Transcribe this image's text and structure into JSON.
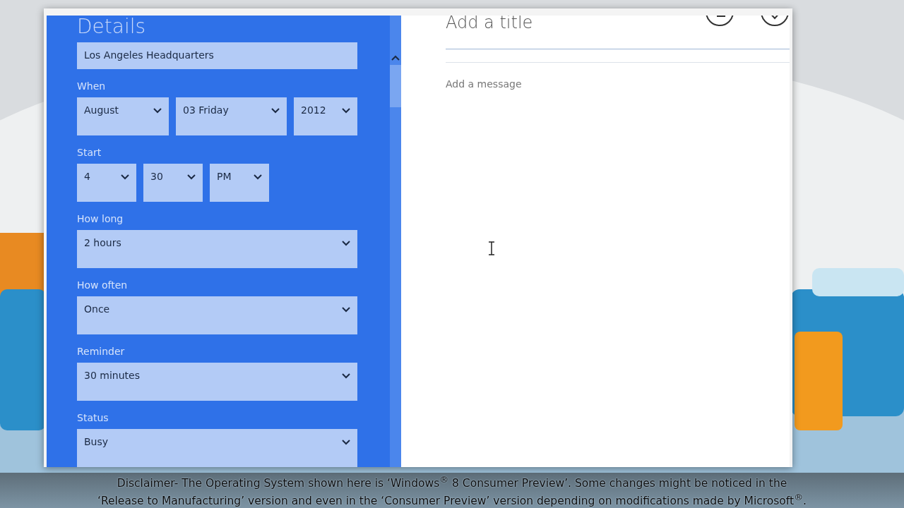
{
  "details": {
    "title": "Details",
    "location": "Los Angeles Headquarters",
    "groups": [
      {
        "label": "When",
        "dropdowns": [
          {
            "value": "August"
          },
          {
            "value": "03 Friday"
          },
          {
            "value": "2012"
          }
        ]
      },
      {
        "label": "Start",
        "dropdowns": [
          {
            "value": "4"
          },
          {
            "value": "30"
          },
          {
            "value": "PM"
          }
        ]
      },
      {
        "label": "How long",
        "dropdowns": [
          {
            "value": "2 hours"
          }
        ]
      },
      {
        "label": "How often",
        "dropdowns": [
          {
            "value": "Once"
          }
        ]
      },
      {
        "label": "Reminder",
        "dropdowns": [
          {
            "value": "30 minutes"
          }
        ]
      },
      {
        "label": "Status",
        "dropdowns": [
          {
            "value": "Busy"
          }
        ]
      }
    ]
  },
  "event": {
    "title_placeholder": "Add a title",
    "message_placeholder": "Add a message"
  },
  "caption": {
    "line_1": "Disclaimer- The Operating System shown here is ‘Windows$^{®}$ 8 Consumer Preview’. Some changes might be noticed in the",
    "line_2": "‘Release to Manufacturing’ version and even in the ‘Consumer Preview’ version depending on modifications made by Microsoft$^{®}$."
  }
}
